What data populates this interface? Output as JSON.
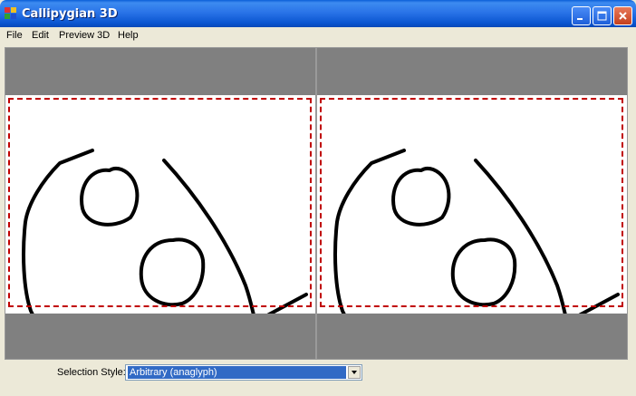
{
  "window": {
    "title": "Callipygian 3D",
    "controls": [
      "minimize-icon",
      "maximize-icon",
      "close-icon"
    ]
  },
  "menu": {
    "items": [
      "File",
      "Edit",
      "Preview 3D",
      "Help"
    ]
  },
  "panels": {
    "left": {
      "selection_color": "#C00000"
    },
    "right": {
      "selection_color": "#C00000"
    }
  },
  "footer": {
    "selection_style_label": "Selection Style:",
    "selection_style_value": "Arbitrary (anaglyph)"
  },
  "colors": {
    "titlebar": "#0A55D0",
    "selection_highlight": "#316AC5",
    "gray_band": "#808080"
  }
}
